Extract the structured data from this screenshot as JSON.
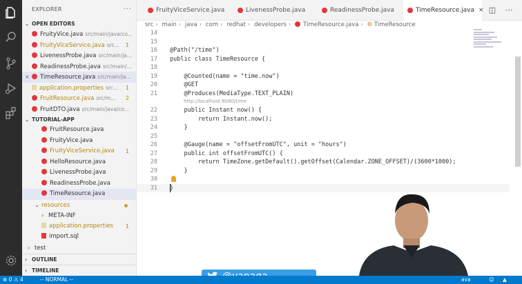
{
  "sidebar": {
    "title": "EXPLORER",
    "more": "···",
    "open_editors": {
      "header": "OPEN EDITORS",
      "items": [
        {
          "name": "FruityVice.java",
          "path": "src/main/java/co...",
          "type": "java",
          "modified": false,
          "badge": "",
          "close": false
        },
        {
          "name": "FruityViceService.java",
          "path": "src...",
          "type": "java",
          "modified": true,
          "badge": "1",
          "close": false
        },
        {
          "name": "LivenessProbe.java",
          "path": "src/main/ja...",
          "type": "java",
          "modified": false,
          "badge": "",
          "close": false
        },
        {
          "name": "ReadinessProbe.java",
          "path": "src/main/...",
          "type": "java",
          "modified": false,
          "badge": "",
          "close": false
        },
        {
          "name": "TimeResource.java",
          "path": "src/main/ja...",
          "type": "java",
          "modified": false,
          "badge": "",
          "close": true
        },
        {
          "name": "application.properties",
          "path": "src...",
          "type": "props",
          "modified": true,
          "badge": "1",
          "close": false
        },
        {
          "name": "FruitResource.java",
          "path": "src/m...",
          "type": "java",
          "modified": true,
          "badge": "2",
          "close": false
        },
        {
          "name": "FruitDTO.java",
          "path": "src/main/java/co...",
          "type": "java",
          "modified": false,
          "badge": "",
          "close": false
        }
      ]
    },
    "tutorial_app": {
      "header": "TUTORIAL-APP",
      "items": [
        {
          "name": "FruitResource.java",
          "kind": "java",
          "indent": 1,
          "modified": false,
          "badge": ""
        },
        {
          "name": "FruityVice.java",
          "kind": "java",
          "indent": 1,
          "modified": false,
          "badge": ""
        },
        {
          "name": "FruityViceService.java",
          "kind": "java",
          "indent": 1,
          "modified": true,
          "badge": "1"
        },
        {
          "name": "HelloResource.java",
          "kind": "java",
          "indent": 1,
          "modified": false,
          "badge": ""
        },
        {
          "name": "LivenessProbe.java",
          "kind": "java",
          "indent": 1,
          "modified": false,
          "badge": ""
        },
        {
          "name": "ReadinessProbe.java",
          "kind": "java",
          "indent": 1,
          "modified": false,
          "badge": ""
        },
        {
          "name": "TimeResource.java",
          "kind": "java",
          "indent": 1,
          "modified": false,
          "badge": "",
          "active": true
        },
        {
          "name": "resources",
          "kind": "folder-open",
          "indent": 0,
          "modified": true,
          "badge": "dot"
        },
        {
          "name": "META-INF",
          "kind": "folder",
          "indent": 1,
          "modified": false,
          "badge": ""
        },
        {
          "name": "application.properties",
          "kind": "props",
          "indent": 1,
          "modified": true,
          "badge": "1"
        },
        {
          "name": "import.sql",
          "kind": "sql",
          "indent": 1,
          "modified": false,
          "badge": ""
        },
        {
          "name": "test",
          "kind": "folder",
          "indent": -1,
          "modified": false,
          "badge": ""
        }
      ]
    },
    "outline_header": "OUTLINE",
    "timeline_header": "TIMELINE"
  },
  "tabs": [
    {
      "label": "FruityViceService.java",
      "active": false
    },
    {
      "label": "LivenessProbe.java",
      "active": false
    },
    {
      "label": "ReadinessProbe.java",
      "active": false
    },
    {
      "label": "TimeResource.java",
      "active": true
    }
  ],
  "tab_close": "×",
  "breadcrumb": [
    "src",
    "main",
    "java",
    "com",
    "redhat",
    "developers",
    "TimeResource.java",
    "TimeResource"
  ],
  "editor": {
    "hint_text": "http://localhost:8080/time",
    "lines": [
      {
        "n": "14",
        "t": ""
      },
      {
        "n": "15",
        "t": ""
      },
      {
        "n": "16",
        "t": "@Path(\"/time\")"
      },
      {
        "n": "17",
        "t": "public class TimeResource {"
      },
      {
        "n": "18",
        "t": ""
      },
      {
        "n": "19",
        "t": "    @Counted(name = \"time.now\")"
      },
      {
        "n": "20",
        "t": "    @GET"
      },
      {
        "n": "21",
        "t": "    @Produces(MediaType.TEXT_PLAIN)"
      },
      {
        "n": "22",
        "t": "    public Instant now() {"
      },
      {
        "n": "23",
        "t": "        return Instant.now();"
      },
      {
        "n": "24",
        "t": "    }"
      },
      {
        "n": "25",
        "t": ""
      },
      {
        "n": "26",
        "t": "    @Gauge(name = \"offsetFromUTC\", unit = \"hours\")"
      },
      {
        "n": "27",
        "t": "    public int offsetFromUTC() {"
      },
      {
        "n": "28",
        "t": "        return TimeZone.getDefault().getOffset(Calendar.ZONE_OFFSET)/(3600*1000);"
      },
      {
        "n": "29",
        "t": "    }"
      },
      {
        "n": "30",
        "t": ""
      },
      {
        "n": "31",
        "t": "}"
      }
    ]
  },
  "statusbar": {
    "errors": "0",
    "warnings": "4",
    "mode": "-- NORMAL --",
    "right": "ava"
  },
  "overlay": {
    "twitter_handle": "@yanaga"
  }
}
